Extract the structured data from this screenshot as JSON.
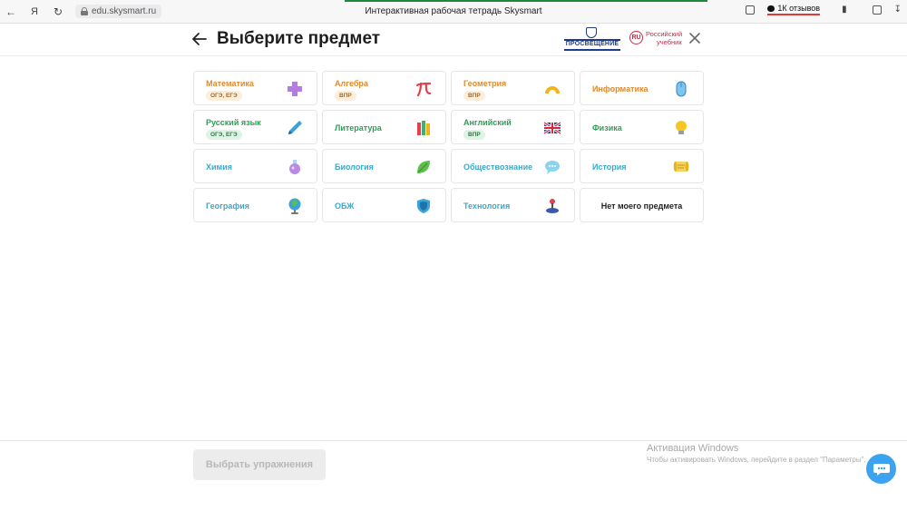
{
  "browser": {
    "url": "edu.skysmart.ru",
    "tab_title": "Интерактивная рабочая тетрадь Skysmart",
    "yandex_glyph": "Я",
    "reviews_label": "1К отзывов"
  },
  "header": {
    "title": "Выберите предмет",
    "logo1_text": "ПРОСВЕЩЕНИЕ",
    "logo2_ring": "RU",
    "logo2_line1": "Российский",
    "logo2_line2": "учебник"
  },
  "subjects": [
    {
      "name": "Математика",
      "badge": "ОГЭ, ЕГЭ",
      "color": "orange",
      "icon": "plus-icon"
    },
    {
      "name": "Алгебра",
      "badge": "ВПР",
      "color": "orange",
      "icon": "pi-icon"
    },
    {
      "name": "Геометрия",
      "badge": "ВПР",
      "color": "orange",
      "icon": "protractor-icon"
    },
    {
      "name": "Информатика",
      "badge": "",
      "color": "orange",
      "icon": "mouse-icon"
    },
    {
      "name": "Русский язык",
      "badge": "ОГЭ, ЕГЭ",
      "color": "green",
      "icon": "pen-icon"
    },
    {
      "name": "Литература",
      "badge": "",
      "color": "green",
      "icon": "books-icon"
    },
    {
      "name": "Английский",
      "badge": "ВПР",
      "color": "green",
      "icon": "uk-flag-icon"
    },
    {
      "name": "Физика",
      "badge": "",
      "color": "green",
      "icon": "bulb-icon"
    },
    {
      "name": "Химия",
      "badge": "",
      "color": "blue",
      "icon": "flask-icon"
    },
    {
      "name": "Биология",
      "badge": "",
      "color": "blue",
      "icon": "leaf-icon"
    },
    {
      "name": "Обществознание",
      "badge": "",
      "color": "blue",
      "icon": "speech-bubble-icon"
    },
    {
      "name": "История",
      "badge": "",
      "color": "blue",
      "icon": "scroll-icon"
    },
    {
      "name": "География",
      "badge": "",
      "color": "blue",
      "icon": "globe-icon"
    },
    {
      "name": "ОБЖ",
      "badge": "",
      "color": "blue",
      "icon": "shield-icon"
    },
    {
      "name": "Технология",
      "badge": "",
      "color": "blue",
      "icon": "joystick-icon"
    },
    {
      "name": "Нет моего предмета",
      "badge": "",
      "color": "dark",
      "icon": ""
    }
  ],
  "footer": {
    "select_button": "Выбрать упражнения",
    "activation_title": "Активация Windows",
    "activation_text": "Чтобы активировать Windows, перейдите в раздел \"Параметры\"."
  },
  "colors": {
    "orange": "#e08a2e",
    "green": "#2e9d57",
    "blue": "#3fa7c6",
    "chat": "#3ba3f0"
  }
}
